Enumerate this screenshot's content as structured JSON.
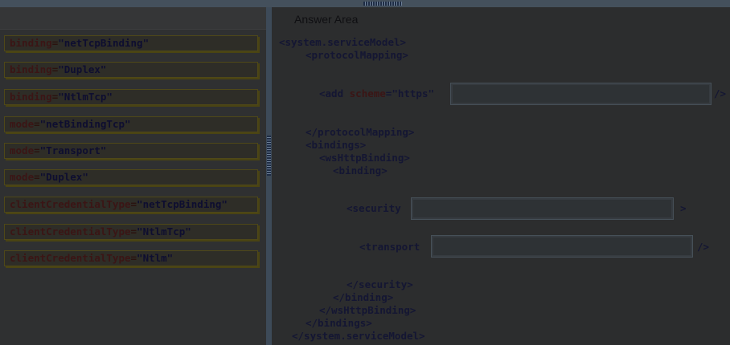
{
  "answer_area": {
    "title": "Answer Area"
  },
  "options": [
    {
      "attr": "binding",
      "value": "\"netTcpBinding\""
    },
    {
      "attr": "binding",
      "value": "\"Duplex\""
    },
    {
      "attr": "binding",
      "value": "\"NtlmTcp\""
    },
    {
      "attr": "mode",
      "value": "\"netBindingTcp\""
    },
    {
      "attr": "mode",
      "value": "\"Transport\""
    },
    {
      "attr": "mode",
      "value": "\"Duplex\""
    },
    {
      "attr": "clientCredentialType",
      "value": "\"netTcpBinding\""
    },
    {
      "attr": "clientCredentialType",
      "value": "\"NtlmTcp\""
    },
    {
      "attr": "clientCredentialType",
      "value": "\"Ntlm\""
    }
  ],
  "code": {
    "line1": "<system.serviceModel>",
    "line2": "<protocolMapping>",
    "add_open": "<add ",
    "add_scheme_attr": "scheme",
    "add_scheme_val": "=\"https\"",
    "add_close": "/>",
    "line4": "</protocolMapping>",
    "line5": "<bindings>",
    "line6": "<wsHttpBinding>",
    "line7": "<binding>",
    "security_open": "<security",
    "security_close": ">",
    "transport_open": "<transport",
    "transport_close": "/>",
    "line10": "</security>",
    "line11": "</binding>",
    "line12": "</wsHttpBinding>",
    "line13": "</bindings>",
    "line14": "</system.serviceModel>"
  },
  "colors": {
    "background": "#2a2b2d",
    "chip_border": "#4f4818",
    "drop_zone": "#2e3235"
  }
}
